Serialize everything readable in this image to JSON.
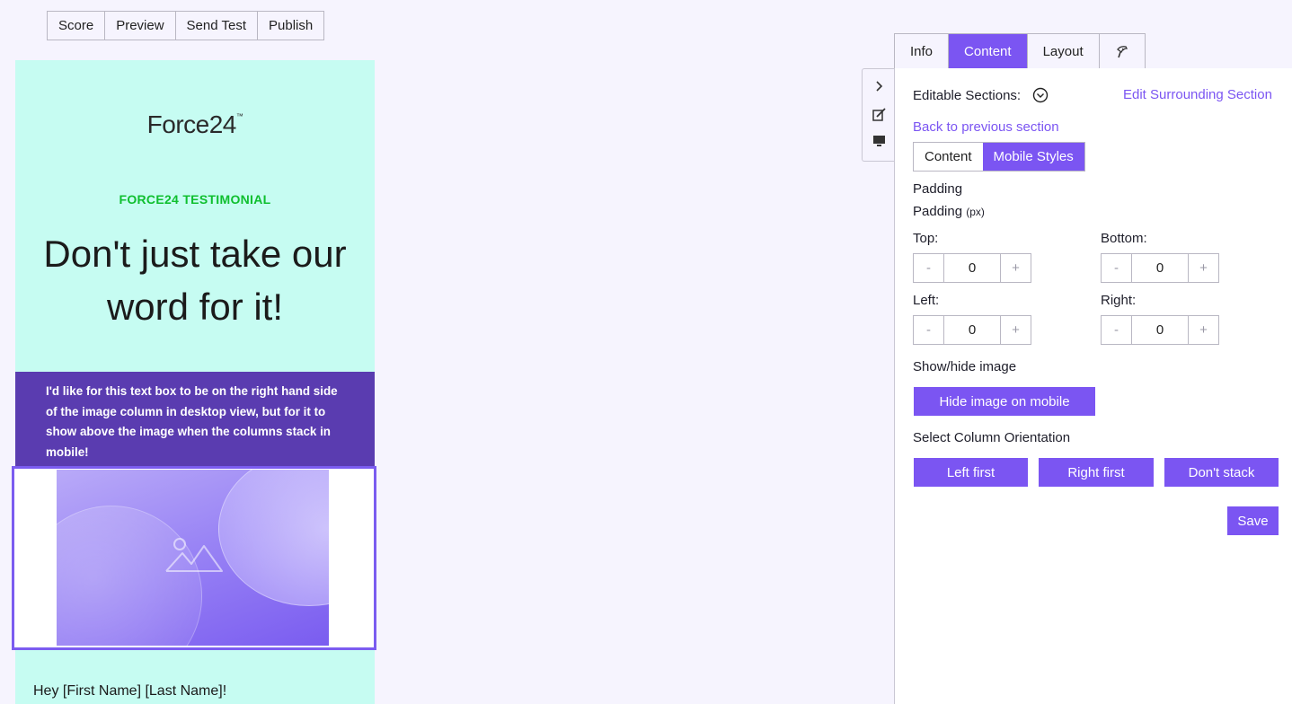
{
  "toolbar": {
    "score": "Score",
    "preview": "Preview",
    "send_test": "Send Test",
    "publish": "Publish"
  },
  "email": {
    "logo_text": "Force24",
    "logo_tm": "™",
    "testimonial_label": "FORCE24 TESTIMONIAL",
    "headline": "Don't just take our word for it!",
    "purple_text": "I'd like for this text box to be on the right hand side of the image column in desktop view, but for it to show above the image when the columns stack in mobile!",
    "greeting": "Hey [First Name] [Last Name]!"
  },
  "tabs": {
    "info": "Info",
    "content": "Content",
    "layout": "Layout"
  },
  "panel": {
    "editable_sections": "Editable Sections:",
    "edit_surrounding": "Edit Surrounding Section",
    "back_link": "Back to previous section",
    "subtab_content": "Content",
    "subtab_mobile": "Mobile Styles",
    "padding_title": "Padding",
    "padding_label": "Padding",
    "padding_unit": "(px)",
    "top_label": "Top:",
    "bottom_label": "Bottom:",
    "left_label": "Left:",
    "right_label": "Right:",
    "top_value": "0",
    "bottom_value": "0",
    "left_value": "0",
    "right_value": "0",
    "minus": "-",
    "plus": "+",
    "show_hide_title": "Show/hide image",
    "hide_image_btn": "Hide image on mobile",
    "column_orientation_title": "Select Column Orientation",
    "left_first": "Left first",
    "right_first": "Right first",
    "dont_stack": "Don't stack",
    "save": "Save"
  },
  "colors": {
    "accent": "#7b55f2",
    "purple_box": "#5a3cb0",
    "email_bg": "#c6fcf2",
    "testimonial_green": "#0fbf2f"
  }
}
